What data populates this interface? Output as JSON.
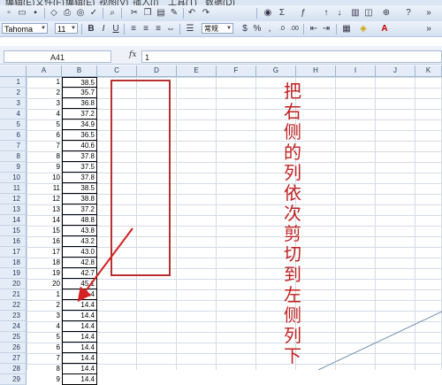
{
  "menu": {
    "items": [
      "编辑(E)",
      "文件(F)",
      "编辑(E)",
      "视图(V)",
      "插入(I)",
      "工具(T)",
      "数据(D)"
    ]
  },
  "toolbar": {
    "font_name": "Tahoma",
    "font_size": "11",
    "number_format": "常规"
  },
  "formula_bar": {
    "name_box": "A41",
    "fx_label": "fx",
    "formula": "1"
  },
  "columns": [
    "A",
    "B",
    "C",
    "D",
    "E",
    "F",
    "G",
    "H",
    "I",
    "J",
    "K"
  ],
  "rows": [
    {
      "n": "1",
      "a": "1",
      "b": "38.5"
    },
    {
      "n": "2",
      "a": "2",
      "b": "35.7"
    },
    {
      "n": "3",
      "a": "3",
      "b": "36.8"
    },
    {
      "n": "4",
      "a": "4",
      "b": "37.2"
    },
    {
      "n": "5",
      "a": "5",
      "b": "34.9"
    },
    {
      "n": "6",
      "a": "6",
      "b": "36.5"
    },
    {
      "n": "7",
      "a": "7",
      "b": "40.6"
    },
    {
      "n": "8",
      "a": "8",
      "b": "37.8"
    },
    {
      "n": "9",
      "a": "9",
      "b": "37.5"
    },
    {
      "n": "10",
      "a": "10",
      "b": "37.8"
    },
    {
      "n": "11",
      "a": "11",
      "b": "38.5"
    },
    {
      "n": "12",
      "a": "12",
      "b": "38.8"
    },
    {
      "n": "13",
      "a": "13",
      "b": "37.2"
    },
    {
      "n": "14",
      "a": "14",
      "b": "48.8"
    },
    {
      "n": "15",
      "a": "15",
      "b": "43.8"
    },
    {
      "n": "16",
      "a": "16",
      "b": "43.2"
    },
    {
      "n": "17",
      "a": "17",
      "b": "43.0"
    },
    {
      "n": "18",
      "a": "18",
      "b": "42.8"
    },
    {
      "n": "19",
      "a": "19",
      "b": "42.7"
    },
    {
      "n": "20",
      "a": "20",
      "b": "45.1"
    },
    {
      "n": "21",
      "a": "1",
      "b": "14.4"
    },
    {
      "n": "22",
      "a": "2",
      "b": "14.4"
    },
    {
      "n": "23",
      "a": "3",
      "b": "14.4"
    },
    {
      "n": "24",
      "a": "4",
      "b": "14.4"
    },
    {
      "n": "25",
      "a": "5",
      "b": "14.4"
    },
    {
      "n": "26",
      "a": "6",
      "b": "14.4"
    },
    {
      "n": "27",
      "a": "7",
      "b": "14.4"
    },
    {
      "n": "28",
      "a": "8",
      "b": "14.4"
    },
    {
      "n": "29",
      "a": "9",
      "b": "14.4"
    }
  ],
  "annotation": {
    "text": "把右侧的列依次剪切到左侧列下",
    "color": "#c02020",
    "box_color": "#b83030"
  }
}
